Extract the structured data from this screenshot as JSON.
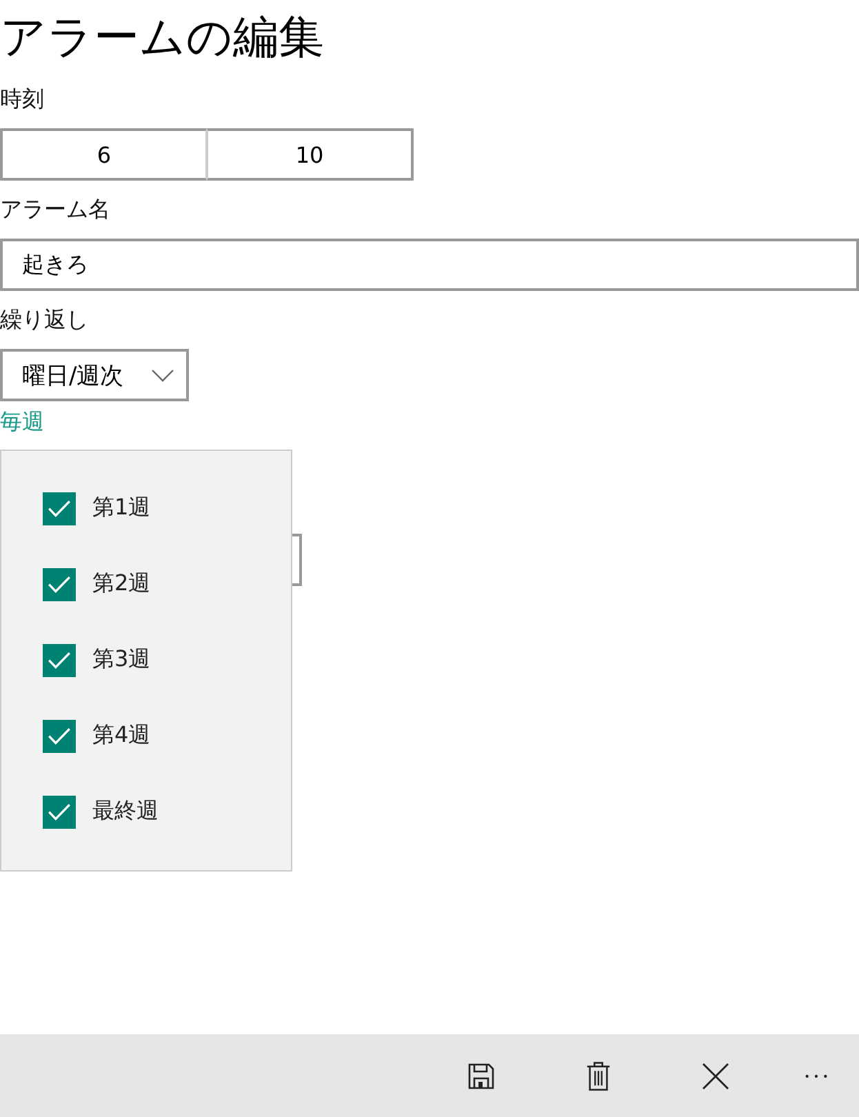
{
  "title": "アラームの編集",
  "time": {
    "label": "時刻",
    "fields": [
      {
        "value": "6"
      },
      {
        "value": "10"
      }
    ]
  },
  "alarm_name": {
    "label": "アラーム名",
    "value": "起きろ"
  },
  "repeat": {
    "label": "繰り返し",
    "dropdown": {
      "value": "曜日/週次"
    },
    "link": "毎週"
  },
  "week_flyout": {
    "items": [
      {
        "label": "第1週",
        "checked": true
      },
      {
        "label": "第2週",
        "checked": true
      },
      {
        "label": "第3週",
        "checked": true
      },
      {
        "label": "第4週",
        "checked": true
      },
      {
        "label": "最終週",
        "checked": true
      }
    ]
  },
  "command_bar": {
    "buttons": [
      {
        "kind": "save"
      },
      {
        "kind": "delete"
      },
      {
        "kind": "close"
      },
      {
        "kind": "more"
      }
    ]
  }
}
